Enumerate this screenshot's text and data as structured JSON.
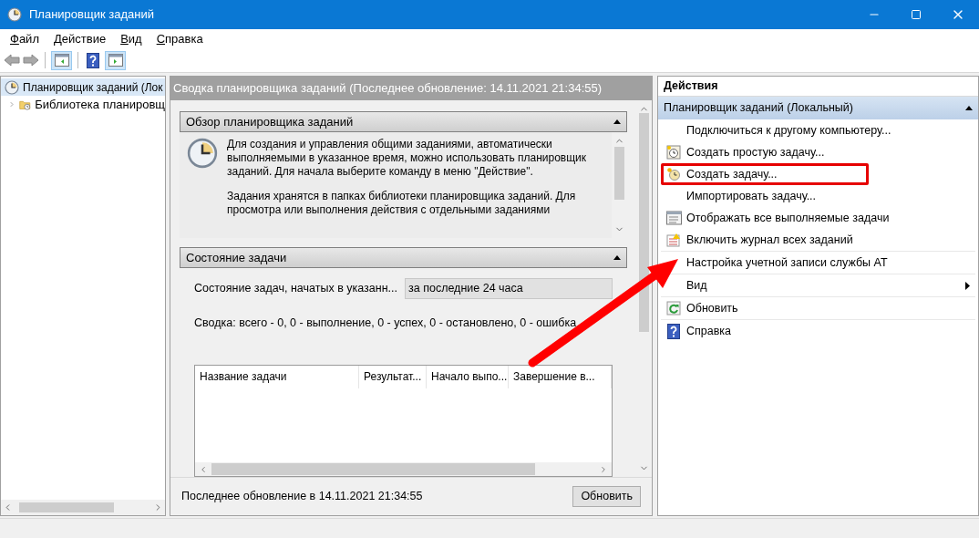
{
  "window": {
    "title": "Планировщик заданий"
  },
  "menu": [
    "Файл",
    "Действие",
    "Вид",
    "Справка"
  ],
  "tree": [
    {
      "label": "Планировщик заданий (Лок",
      "selected": true,
      "children": [
        {
          "label": "Библиотека планировщ",
          "expanded": false
        }
      ]
    }
  ],
  "center": {
    "header": "Сводка планировщика заданий (Последнее обновление: 14.11.2021 21:34:55)",
    "overview": {
      "title": "Обзор планировщика заданий",
      "expanded": true,
      "paragraphs": [
        "Для создания и управления общими заданиями, автоматически выполняемыми в указанное время, можно использовать планировщик заданий. Для начала выберите команду в меню \"Действие\".",
        "Задания хранятся в папках библиотеки планировщика заданий. Для просмотра или выполнения действия с отдельными заданиями"
      ]
    },
    "status": {
      "title": "Состояние задачи",
      "expanded": true,
      "filter_label": "Состояние задач, начатых в указанн...",
      "filter_value": "за последние 24 часа",
      "summary": "Сводка: всего - 0, 0 - выполнение, 0 - успех, 0 - остановлено, 0 - ошибка",
      "columns": [
        "Название задачи",
        "Результат...",
        "Начало выпо...",
        "Завершение в..."
      ]
    },
    "footer": {
      "text": "Последнее обновление в 14.11.2021 21:34:55",
      "button": "Обновить"
    }
  },
  "actions": {
    "title": "Действия",
    "section": {
      "label": "Планировщик заданий (Локальный)",
      "expanded": true
    },
    "groups": [
      [
        {
          "label": "Подключиться к другому компьютеру...",
          "submenu": false,
          "highlighted": false
        },
        {
          "label": "Создать простую задачу...",
          "submenu": false,
          "highlighted": false
        },
        {
          "label": "Создать задачу...",
          "submenu": false,
          "highlighted": true
        },
        {
          "label": "Импортировать задачу...",
          "submenu": false,
          "highlighted": false
        },
        {
          "label": "Отображать все выполняемые задачи",
          "submenu": false,
          "highlighted": false
        },
        {
          "label": "Включить журнал всех заданий",
          "submenu": false,
          "highlighted": false
        }
      ],
      [
        {
          "label": "Настройка учетной записи службы AT",
          "submenu": false,
          "highlighted": false
        }
      ],
      [
        {
          "label": "Вид",
          "submenu": true,
          "highlighted": false
        }
      ],
      [
        {
          "label": "Обновить",
          "submenu": false,
          "highlighted": false
        }
      ],
      [
        {
          "label": "Справка",
          "submenu": false,
          "highlighted": false
        }
      ]
    ]
  }
}
